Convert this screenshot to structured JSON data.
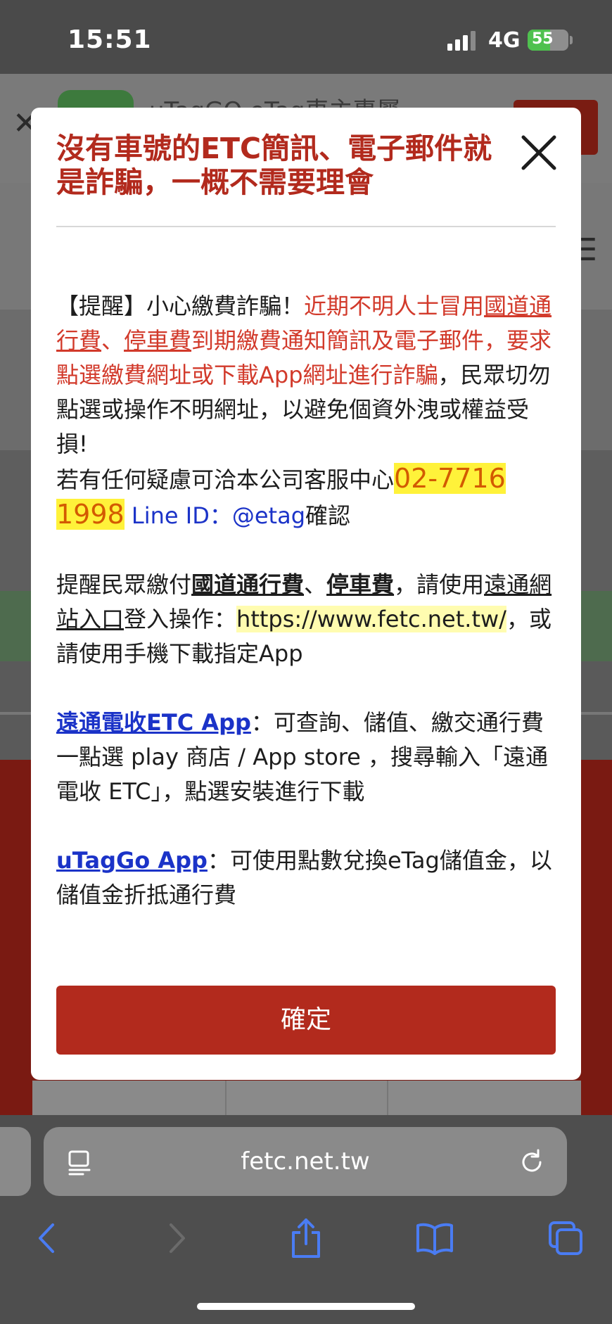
{
  "status_bar": {
    "time": "15:51",
    "network": "4G",
    "battery_percent": 55
  },
  "background": {
    "app_title": "uTagGO eTag車主專屬"
  },
  "modal": {
    "title": "沒有車號的ETC簡訊、電子郵件就是詐騙，一概不需要理會",
    "p1": {
      "prefix": "【提醒】小心繳費詐騙！",
      "red_1": "近期不明人士冒用",
      "link_toll": "國道通行費",
      "sep": "、",
      "link_parking": "停車費",
      "red_2": "到期繳費通知簡訊及電子郵件，要求點選繳費網址或下載App網址進行詐騙",
      "suffix": "，民眾切勿點選或操作不明網址，以避免個資外洩或權益受損!"
    },
    "p2": {
      "prefix": "若有任何疑慮可洽本公司客服中心",
      "phone": "02-7716 1998",
      "line_label": " Line ID：",
      "line_id": "@etag",
      "suffix": "確認"
    },
    "p3": {
      "prefix": "提醒民眾繳付",
      "toll": "國道通行費",
      "sep": "、",
      "parking": "停車費",
      "mid": "，請使用",
      "portal": "遠通網站入口",
      "login": "登入操作：",
      "url": "https://www.fetc.net.tw/",
      "suffix": "，或請使用手機下載指定App"
    },
    "p4": {
      "app": "遠通電收ETC App",
      "desc": "：可查詢、儲值、繳交通行費",
      "line2": "一點選 play 商店 / App store ，搜尋輸入「遠通電收 ETC」，點選安裝進行下載"
    },
    "p5": {
      "app": "uTagGo App",
      "desc": "：可使用點數兌換eTag儲值金，以儲值金折抵通行費"
    },
    "confirm_label": "確定"
  },
  "browser": {
    "url": "fetc.net.tw"
  }
}
